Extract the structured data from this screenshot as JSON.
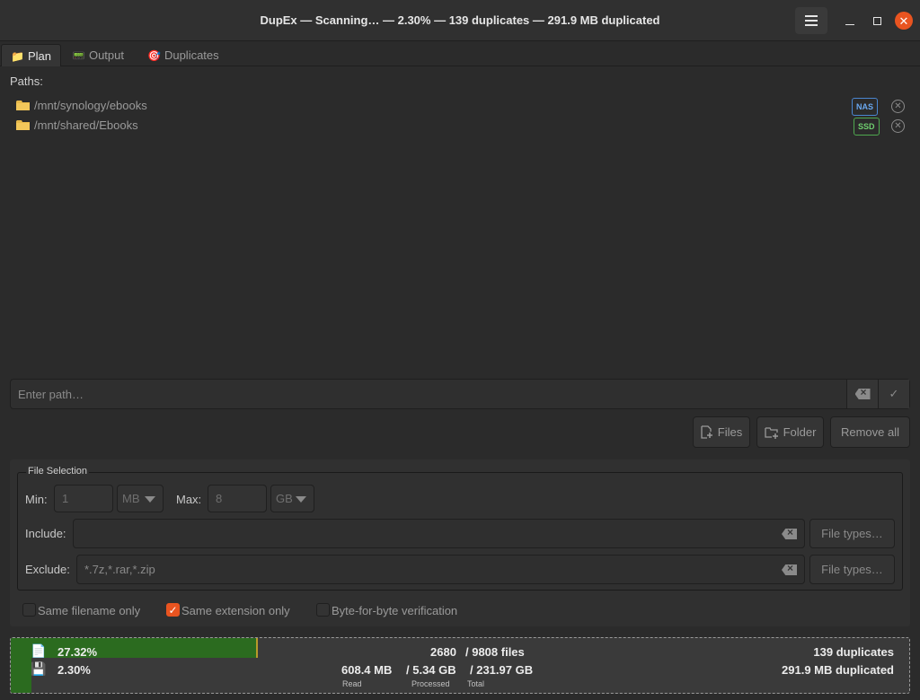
{
  "window": {
    "title": "DupEx — Scanning… — 2.30% — 139 duplicates — 291.9 MB duplicated"
  },
  "tabs": [
    {
      "label": "Plan",
      "icon": "folder-icon"
    },
    {
      "label": "Output",
      "icon": "terminal-icon"
    },
    {
      "label": "Duplicates",
      "icon": "target-icon"
    }
  ],
  "plan": {
    "paths_label": "Paths:",
    "paths": [
      {
        "path": "/mnt/synology/ebooks",
        "badge": "NAS"
      },
      {
        "path": "/mnt/shared/Ebooks",
        "badge": "SSD"
      }
    ],
    "path_entry_placeholder": "Enter path…",
    "buttons": {
      "files": "Files",
      "folder": "Folder",
      "remove_all": "Remove all"
    }
  },
  "file_selection": {
    "legend": "File Selection",
    "min_label": "Min:",
    "min_value": "1",
    "min_unit": "MB",
    "max_label": "Max:",
    "max_value": "8",
    "max_unit": "GB",
    "include_label": "Include:",
    "include_value": "",
    "exclude_label": "Exclude:",
    "exclude_value": "*.7z,*.rar,*.zip",
    "file_types_label": "File types…"
  },
  "options": {
    "same_filename": {
      "label": "Same filename only",
      "checked": false
    },
    "same_extension": {
      "label": "Same extension only",
      "checked": true
    },
    "byte_verify": {
      "label": "Byte-for-byte verification",
      "checked": false
    }
  },
  "status": {
    "files_percent": "27.32%",
    "files_progress": 0.2732,
    "bytes_percent": "2.30%",
    "bytes_progress": 0.023,
    "files_done": "2680",
    "files_total": "/ 9808 files",
    "read": "608.4 MB",
    "processed": "/ 5.34 GB",
    "total": "/ 231.97 GB",
    "read_caption": "Read",
    "processed_caption": "Processed",
    "total_caption": "Total",
    "duplicates": "139 duplicates",
    "duplicated_size": "291.9 MB duplicated"
  },
  "colors": {
    "accent": "#e95420",
    "progress": "#2b6b1f",
    "nas_badge": "#6aa8f0",
    "ssd_badge": "#6fcf6f"
  }
}
